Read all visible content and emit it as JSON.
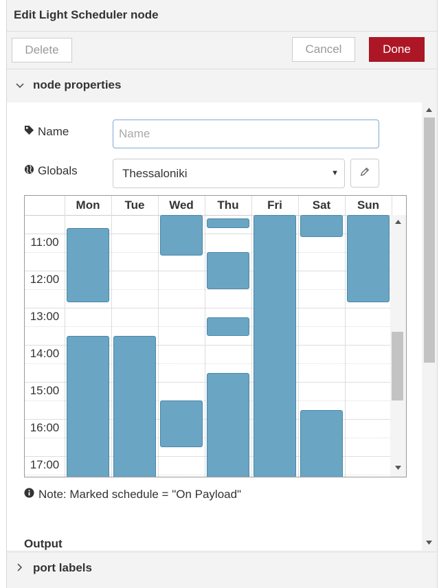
{
  "dialog": {
    "title": "Edit Light Scheduler node"
  },
  "toolbar": {
    "delete_label": "Delete",
    "cancel_label": "Cancel",
    "done_label": "Done"
  },
  "sections": {
    "node_properties": "node properties",
    "port_labels": "port labels"
  },
  "form": {
    "name_label": "Name",
    "name_placeholder": "Name",
    "name_value": "",
    "globals_label": "Globals",
    "globals_value": "Thessaloniki"
  },
  "schedule": {
    "days": [
      "Mon",
      "Tue",
      "Wed",
      "Thu",
      "Fri",
      "Sat",
      "Sun"
    ],
    "times": [
      "11:00",
      "12:00",
      "13:00",
      "14:00",
      "15:00",
      "16:00",
      "17:00"
    ],
    "visible_range_hours": [
      10.5,
      17.55
    ]
  },
  "note": {
    "text": "Note: Marked schedule = \"On Payload\""
  },
  "output": {
    "label": "Output"
  },
  "colors": {
    "accent": "#ad1625",
    "block_fill": "#6aa5c4",
    "block_border": "#4a86a8"
  },
  "icons": {
    "collapse": "chevron-down-icon",
    "expand": "chevron-right-icon",
    "name": "tag-icon",
    "globals": "globe-icon",
    "edit": "pencil-icon",
    "note": "info-icon"
  }
}
